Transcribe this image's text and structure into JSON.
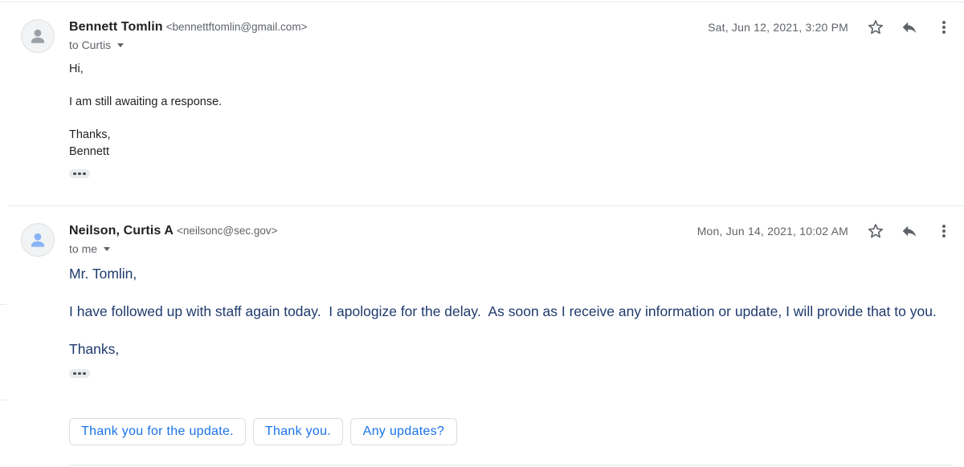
{
  "messages": [
    {
      "sender_name": "Bennett Tomlin",
      "sender_email": "<bennettftomlin@gmail.com>",
      "recipient": "to Curtis",
      "date": "Sat, Jun 12, 2021, 3:20 PM",
      "body": [
        "Hi,",
        "I am still awaiting a response.",
        "Thanks,",
        "Bennett"
      ]
    },
    {
      "sender_name": "Neilson, Curtis A",
      "sender_email": "<neilsonc@sec.gov>",
      "recipient": "to me",
      "date": "Mon, Jun 14, 2021, 10:02 AM",
      "body": [
        "Mr. Tomlin,",
        "I have followed up with staff again today.  I apologize for the delay.  As soon as I receive any information or update, I will provide that to you.",
        "Thanks,"
      ]
    }
  ],
  "smart_replies": [
    "Thank you for the update.",
    "Thank you.",
    "Any updates?"
  ],
  "icons": {
    "avatar": "person-icon",
    "star": "star-icon",
    "reply": "reply-icon",
    "more": "more-vertical-icon",
    "ellipsis": "show-trimmed-content-icon"
  },
  "colors": {
    "reply_chip_text": "#1a73e8",
    "second_body_text": "#1f3a6d",
    "muted_text": "#5f6368"
  }
}
